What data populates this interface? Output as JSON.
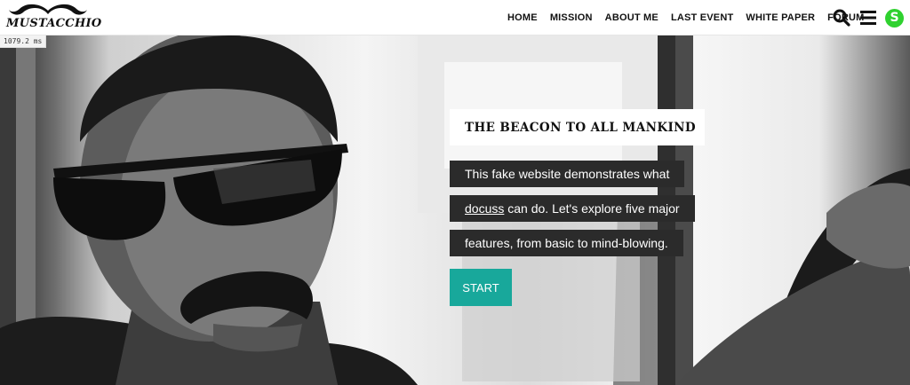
{
  "header": {
    "logo_text": "MUSTACCHIO",
    "nav": [
      {
        "label": "HOME"
      },
      {
        "label": "MISSION"
      },
      {
        "label": "ABOUT ME"
      },
      {
        "label": "LAST EVENT"
      },
      {
        "label": "WHITE PAPER"
      },
      {
        "label": "FORUM"
      }
    ],
    "tools": {
      "search_icon": "search-icon",
      "menu_icon": "hamburger-menu-icon",
      "sync_badge_letter": "S",
      "sync_badge_color": "#2fd12f"
    }
  },
  "timer": {
    "text": "1079.2 ms"
  },
  "hero": {
    "photo": "black-and-white photo of a man with sunglasses and mustache driving a car",
    "title": "THE BEACON TO ALL MANKIND",
    "description": {
      "line1": "This fake website demonstrates what",
      "line2_link": "docuss",
      "line2_rest": " can do. Let's explore five major",
      "line3": "features, from basic to mind-blowing."
    },
    "start_label": "START",
    "accent_color": "#18a89b"
  }
}
